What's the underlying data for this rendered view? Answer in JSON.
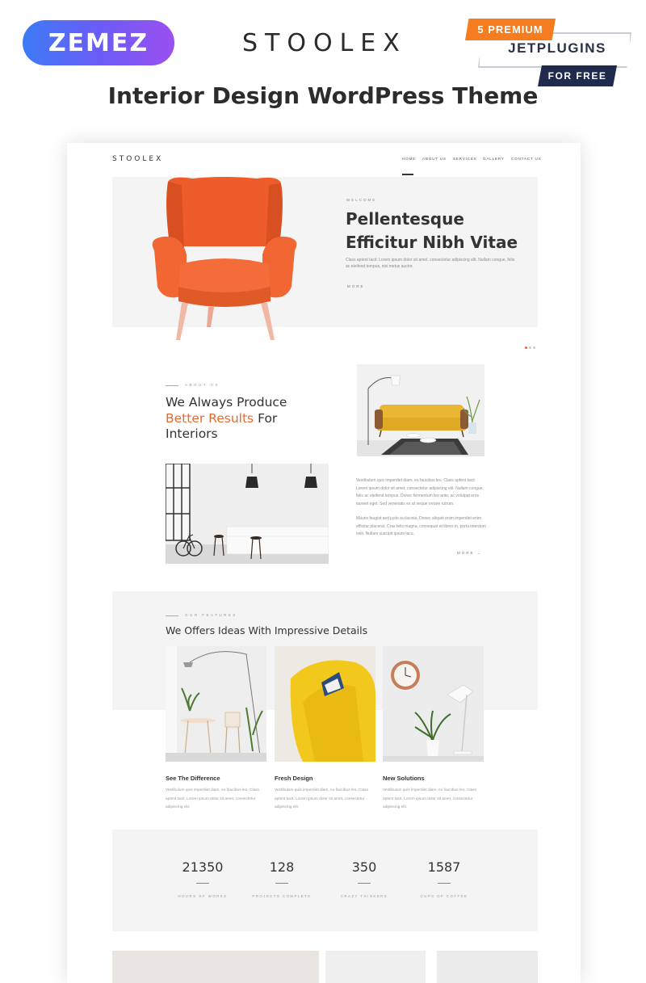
{
  "promo": {
    "vendor_logo": "ZEMEZ",
    "brand_title": "STOOLEX",
    "main_title": "Interior Design WordPress Theme",
    "badge": {
      "premium": "5 PREMIUM",
      "plugins": "JETPLUGINS",
      "free": "FOR FREE"
    }
  },
  "site": {
    "logo": "STOOLEX",
    "nav": [
      "HOME",
      "ABOUT US",
      "SERVICES",
      "GALLERY",
      "CONTACT US"
    ],
    "hero": {
      "eyebrow": "WELCOME",
      "title": "Pellentesque Efficitur Nibh Vitae",
      "text": "Class aptent tacit. Lorem ipsum dolor sit amet, consectetur adipiscing elit. Nullam congue, felis ac eleifend tempus, nisi metus auctor.",
      "more": "MORE"
    },
    "about": {
      "eyebrow": "ABOUT US",
      "title_line1": "We Always Produce",
      "title_accent": "Better Results",
      "title_rest": "For",
      "title_line3": "Interiors",
      "p1": "Vestibulum quis imperdiet diam, eu faucibus leo. Class aptent tacit. Lorem ipsum dolor sit amet, consectetur adipiscing elit. Nullam congue, felis ac eleifend tempus. Donec fermentum leo ante, ac volutpat eros laoreet eget. Sed venenatis ex at neque ornare rutrum.",
      "p2": "Mauris feugiat sed justo eu lacinia. Donec aliquet enim imperdiet enim efficitur placerat. Cras felis magna, consequat et libero in, porta interdum velit. Nullam suscipit ipsum lacu.",
      "more": "MORE →"
    },
    "features": {
      "eyebrow": "OUR FEATURES",
      "title": "We Offers Ideas With Impressive Details",
      "items": [
        {
          "title": "See The Difference",
          "text": "Vestibulum quis imperdiet diam, eu faucibus leo. Class aptent tacit. Lorem ipsum dolor sit amet, consectetur adipiscing elit."
        },
        {
          "title": "Fresh Design",
          "text": "Vestibulum quis imperdiet diam, eu faucibus leo. Class aptent tacit. Lorem ipsum dolor sit amet, consectetur adipiscing elit."
        },
        {
          "title": "New Solutions",
          "text": "Vestibulum quis imperdiet diam, eu faucibus leo. Class aptent tacit. Lorem ipsum dolor sit amet, consectetur adipiscing elit."
        }
      ]
    },
    "stats": [
      {
        "value": "21350",
        "label": "HOURS OF WORKS"
      },
      {
        "value": "128",
        "label": "PROJECTS COMPLETE"
      },
      {
        "value": "350",
        "label": "CRAZY THINKERS"
      },
      {
        "value": "1587",
        "label": "CUPS OF COFFEE"
      }
    ]
  },
  "colors": {
    "accent": "#e8692e",
    "chair": "#f0602e",
    "sofa": "#e9b733",
    "feature_chair": "#f3c81c",
    "premium_badge": "#f57c1f",
    "free_badge": "#1f2a4d"
  }
}
